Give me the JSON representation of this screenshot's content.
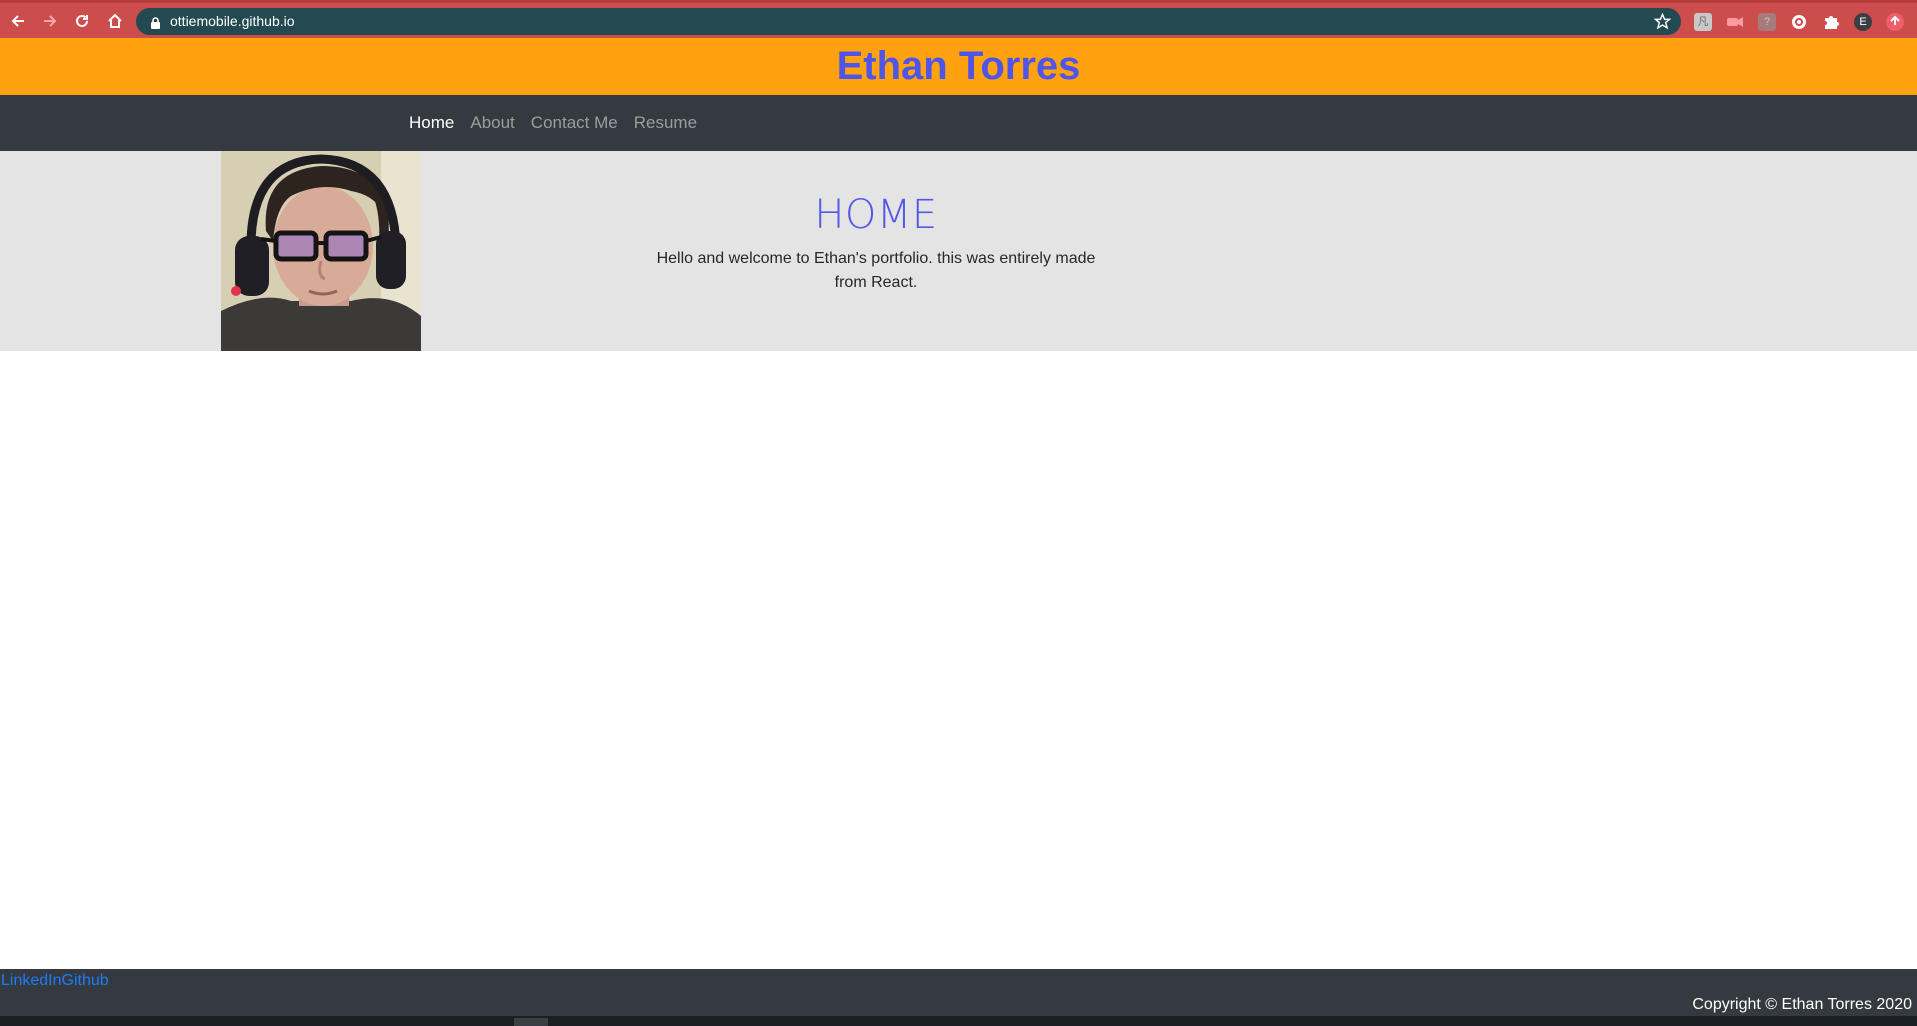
{
  "browser": {
    "url": "ottiemobile.github.io",
    "profile_initial": "E",
    "icons": [
      "back-arrow-icon",
      "forward-arrow-icon",
      "reload-icon",
      "home-icon",
      "lock-icon",
      "star-icon",
      "extensions-puzzle-icon"
    ],
    "theme_color": "#cd4c4c",
    "address_bar_color": "#244a51"
  },
  "header": {
    "title": "Ethan Torres",
    "background": "#fea20f",
    "title_color": "#4f55e8"
  },
  "nav": {
    "items": [
      {
        "label": "Home",
        "active": true
      },
      {
        "label": "About",
        "active": false
      },
      {
        "label": "Contact Me",
        "active": false
      },
      {
        "label": "Resume",
        "active": false
      }
    ],
    "background": "#343a40"
  },
  "hero": {
    "heading": "HOME",
    "text": "Hello and welcome to Ethan's portfolio. this was entirely made from React.",
    "heading_color": "#5359e6",
    "background": "#e4e4e4"
  },
  "footer": {
    "links": [
      "LinkedIn",
      "Github"
    ],
    "copyright": "Copyright © Ethan Torres 2020",
    "link_color": "#1f7bf2"
  }
}
